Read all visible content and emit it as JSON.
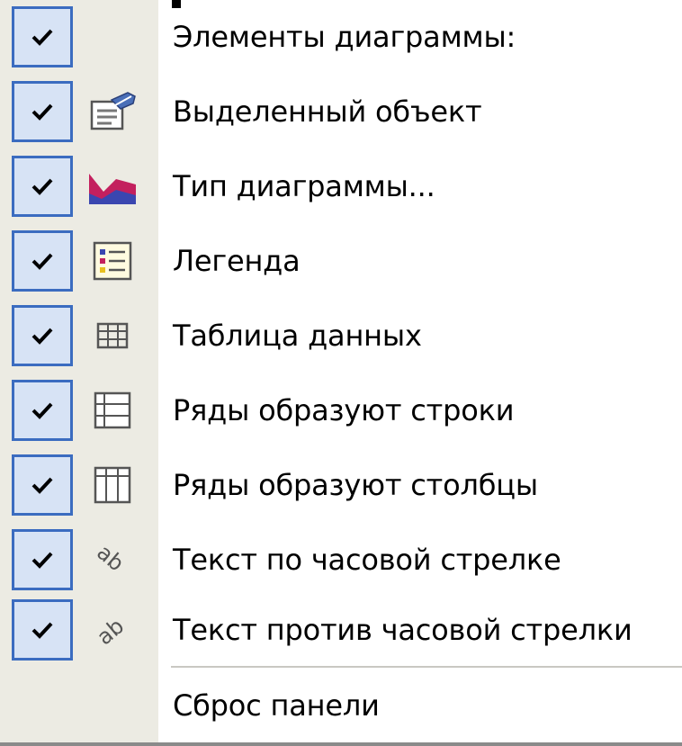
{
  "menu": {
    "items": [
      {
        "label": "Элементы диаграммы:",
        "checked": true,
        "icon": "none"
      },
      {
        "label": "Выделенный объект",
        "checked": true,
        "icon": "format-object-icon"
      },
      {
        "label": "Тип диаграммы...",
        "checked": true,
        "icon": "area-chart-icon"
      },
      {
        "label": "Легенда",
        "checked": true,
        "icon": "legend-icon"
      },
      {
        "label": "Таблица данных",
        "checked": true,
        "icon": "data-table-icon"
      },
      {
        "label": "Ряды образуют строки",
        "checked": true,
        "icon": "series-by-rows-icon"
      },
      {
        "label": "Ряды образуют столбцы",
        "checked": true,
        "icon": "series-by-columns-icon"
      },
      {
        "label": "Текст по часовой стрелке",
        "checked": true,
        "icon": "text-clockwise-icon"
      },
      {
        "label": "Текст против часовой стрелки",
        "checked": true,
        "icon": "text-counterclockwise-icon"
      }
    ],
    "reset_label": "Сброс панели"
  },
  "colors": {
    "gutter": "#ecebe3",
    "check_border": "#3b6cc0",
    "check_fill": "#d7e3f5"
  }
}
